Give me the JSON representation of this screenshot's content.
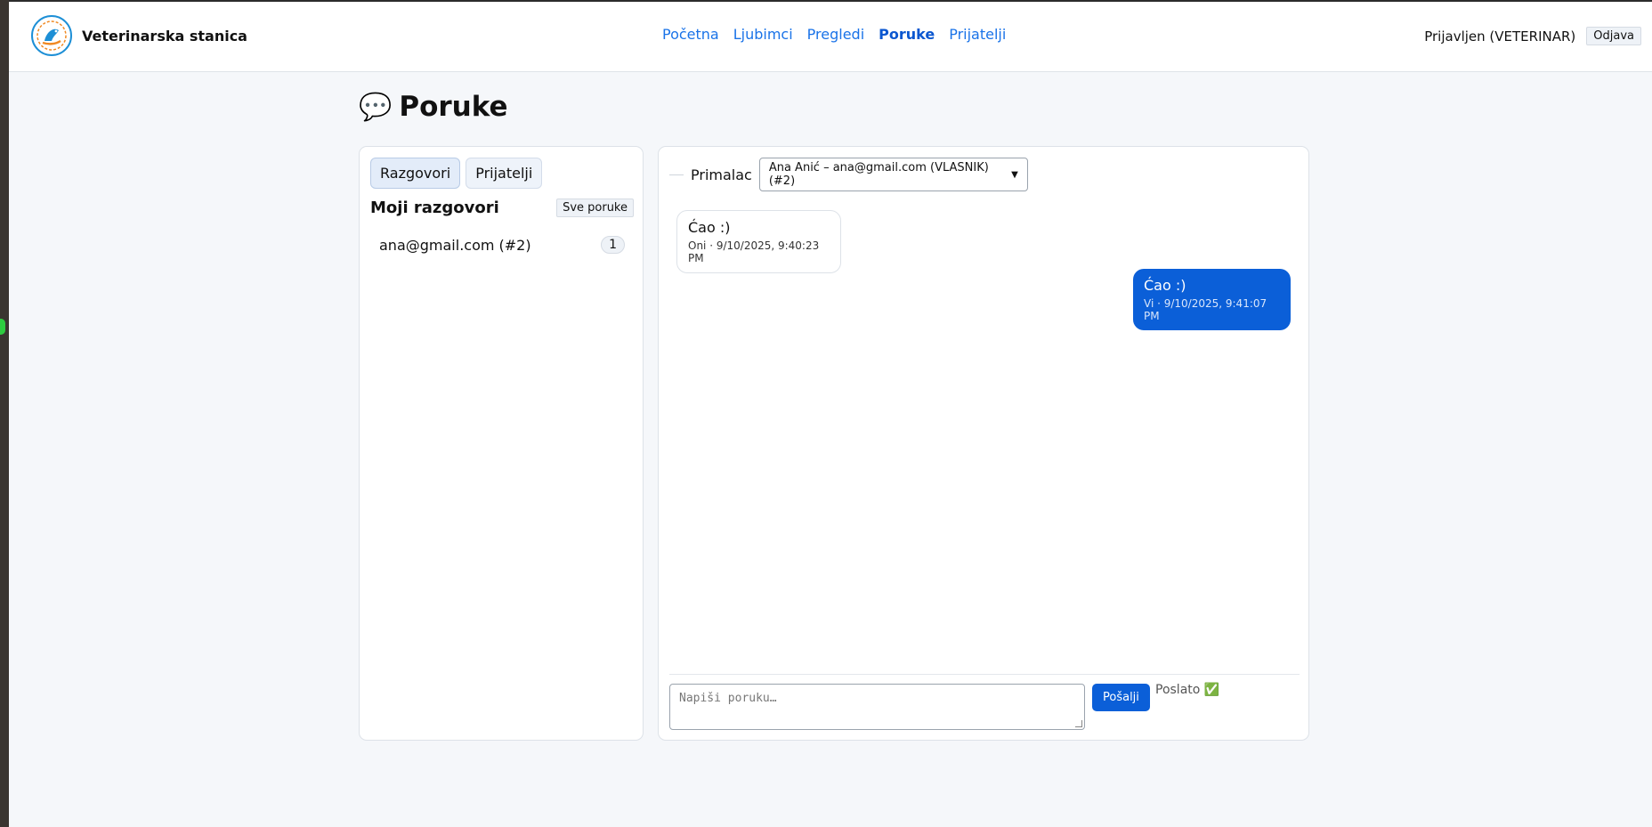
{
  "header": {
    "brand_name": "Veterinarska stanica",
    "nav": [
      "Početna",
      "Ljubimci",
      "Pregledi",
      "Poruke",
      "Prijatelji"
    ],
    "active_nav": "Poruke",
    "user_label": "Prijavljen (VETERINAR)",
    "logout_label": "Odjava"
  },
  "page": {
    "emoji": "💬",
    "title": "Poruke"
  },
  "sidebar": {
    "tabs": [
      "Razgovori",
      "Prijatelji"
    ],
    "active_tab": "Razgovori",
    "section_title": "Moji razgovori",
    "all_messages_label": "Sve poruke",
    "conversations": [
      {
        "label": "ana@gmail.com (#2)",
        "count": "1"
      }
    ]
  },
  "chat": {
    "recipient_label": "Primalac",
    "recipient_value": "Ana Anić – ana@gmail.com (VLASNIK) (#2)",
    "messages": [
      {
        "from": "them",
        "text": "Ćao :)",
        "meta": "Oni · 9/10/2025, 9:40:23 PM"
      },
      {
        "from": "me",
        "text": "Ćao :)",
        "meta": "Vi · 9/10/2025, 9:41:07 PM"
      }
    ],
    "composer_placeholder": "Napiši poruku…",
    "send_label": "Pošalji",
    "status_text": "Poslato ✅"
  },
  "colors": {
    "accent": "#0b5fd8",
    "link": "#1a73e8",
    "background": "#f5f7fa"
  }
}
